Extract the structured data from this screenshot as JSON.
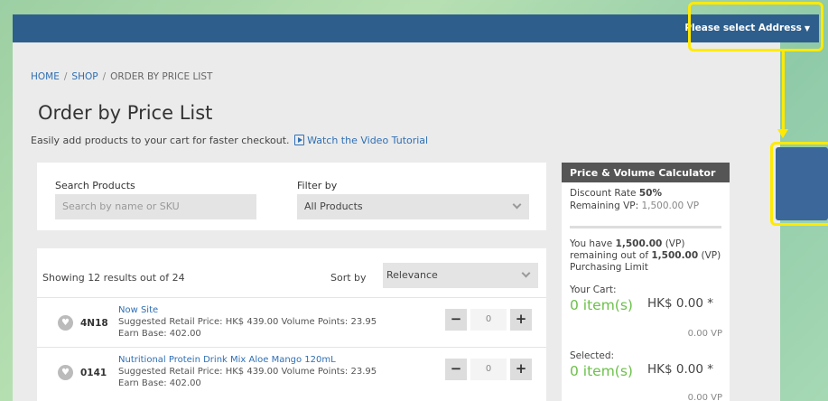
{
  "header": {
    "address_label": "Please select Address"
  },
  "breadcrumb": {
    "home": "HOME",
    "shop": "SHOP",
    "current": "ORDER BY PRICE LIST",
    "separator": "/"
  },
  "page": {
    "title": "Order by Price List",
    "subtitle": "Easily add products to your cart for faster checkout.",
    "video_link": "Watch the Video Tutorial"
  },
  "search": {
    "label": "Search Products",
    "placeholder": "Search by name or SKU",
    "filter_label": "Filter by",
    "filter_value": "All Products"
  },
  "list": {
    "showing": "Showing 12 results out of 24",
    "sort_label": "Sort by",
    "sort_value": "Relevance"
  },
  "products": [
    {
      "sku": "4N18",
      "name": "Now Site",
      "info": "Suggested Retail Price: HK$ 439.00   Volume Points: 23.95",
      "earn": "Earn Base: 402.00",
      "qty": "0"
    },
    {
      "sku": "0141",
      "name": "Nutritional Protein Drink Mix Aloe Mango 120mL",
      "info": "Suggested Retail Price: HK$ 439.00   Volume Points: 23.95",
      "earn": "Earn Base: 402.00",
      "qty": "0"
    }
  ],
  "calculator": {
    "title": "Price & Volume Calculator",
    "discount_label": "Discount Rate ",
    "discount_value": "50%",
    "remaining_label": "Remaining VP: ",
    "remaining_value": "1,500.00 VP",
    "have_pre": "You have ",
    "have_value": "1,500.00",
    "have_unit": " (VP)",
    "remaining_line_pre": "remaining out of ",
    "limit_value": "1,500.00",
    "limit_unit": " (VP)",
    "purchasing_limit": "Purchasing Limit",
    "cart_label": "Your Cart:",
    "cart_items": "0 item(s)",
    "cart_price": "HK$ 0.00 *",
    "cart_vp": "0.00 VP",
    "selected_label": "Selected:",
    "selected_items": "0 item(s)",
    "selected_price": "HK$ 0.00 *",
    "selected_vp": "0.00 VP"
  },
  "icons": {
    "heart": "heart-icon",
    "video": "video-icon",
    "caret": "caret-down-icon",
    "chevron": "chevron-down-icon",
    "minus": "minus-icon",
    "plus": "plus-icon"
  },
  "colors": {
    "header": "#2e5f8c",
    "link": "#2f6fb4",
    "accent_green": "#6cc04a",
    "highlight": "#ffea00"
  }
}
